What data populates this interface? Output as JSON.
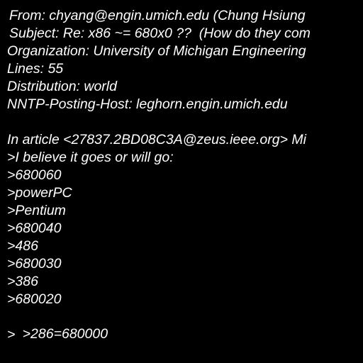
{
  "document": {
    "header": {
      "from": "From: chyang@engin.umich.edu (Chung Hsiung",
      "subject": "Subject: Re: x86 ~= 680x0 ??  (How do they com",
      "organization": "Organization: University of Michigan Engineering",
      "lines": "Lines: 55",
      "distribution": "Distribution: world",
      "nntp_host": "NNTP-Posting-Host: leghorn.engin.umich.edu"
    },
    "body": {
      "attribution": "In article <27837.2BD08C3A@zeus.ieee.org> Mi",
      "quoted": [
        ">I believe it goes or will go:",
        ">680060",
        ">powerPC",
        ">Pentium",
        ">680040",
        ">486",
        ">680030",
        ">386",
        ">680020",
        ">286=680000",
        ">"
      ]
    },
    "colors": {
      "background": "#000000",
      "text": "#ffffff"
    }
  }
}
